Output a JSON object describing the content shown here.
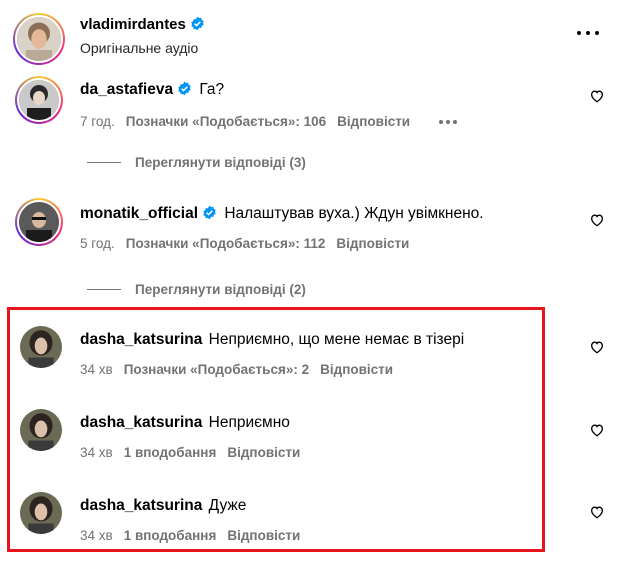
{
  "post_header": {
    "username": "vladimirdantes",
    "audio_label": "Оригінальне аудіо",
    "more_icon": "more-horizontal-icon"
  },
  "comments": [
    {
      "username": "da_astafieva",
      "verified": true,
      "text": "Га?",
      "time": "7 год.",
      "likes_label": "Позначки «Подобається»: 106",
      "reply_label": "Відповісти",
      "replies_label": "Переглянути відповіді (3)"
    },
    {
      "username": "monatik_official",
      "verified": true,
      "text": "Налаштував вуха.) Ждун увімкнено.",
      "time": "5 год.",
      "likes_label": "Позначки «Подобається»: 112",
      "reply_label": "Відповісти",
      "replies_label": "Переглянути відповіді (2)"
    },
    {
      "username": "dasha_katsurina",
      "verified": false,
      "text": "Неприємно, що мене немає в тізері",
      "time": "34 хв",
      "likes_label": "Позначки «Подобається»: 2",
      "reply_label": "Відповісти"
    },
    {
      "username": "dasha_katsurina",
      "verified": false,
      "text": "Неприємно",
      "time": "34 хв",
      "likes_label": "1 вподобання",
      "reply_label": "Відповісти"
    },
    {
      "username": "dasha_katsurina",
      "verified": false,
      "text": "Дуже",
      "time": "34 хв",
      "likes_label": "1 вподобання",
      "reply_label": "Відповісти"
    }
  ],
  "colors": {
    "verified_blue": "#0095f6",
    "meta_gray": "#737373",
    "highlight_red": "#e8141b"
  }
}
